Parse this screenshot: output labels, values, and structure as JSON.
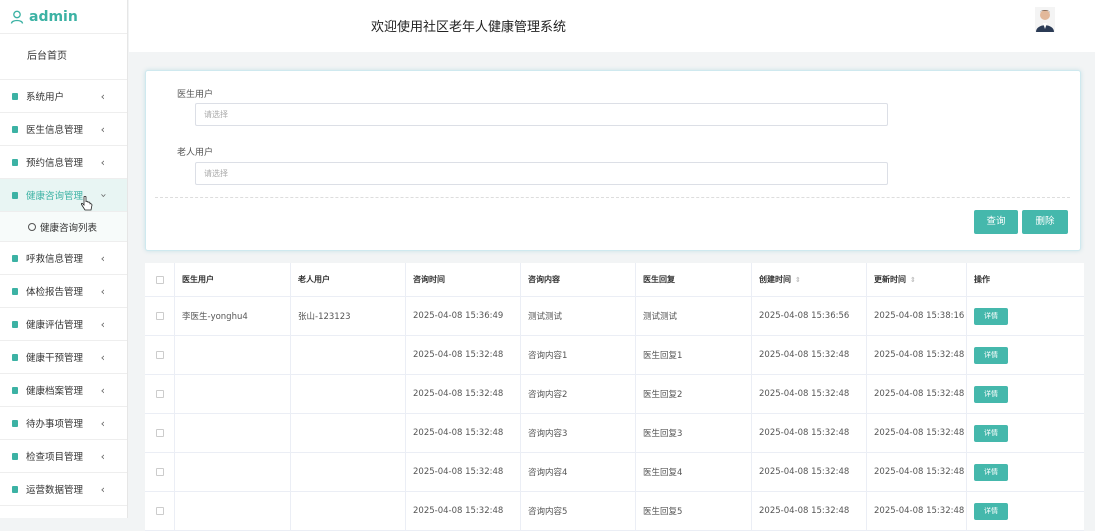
{
  "brand": {
    "username": "admin"
  },
  "header": {
    "title": "欢迎使用社区老年人健康管理系统"
  },
  "sidebar": {
    "home": "后台首页",
    "items": [
      {
        "label": "系统用户"
      },
      {
        "label": "医生信息管理"
      },
      {
        "label": "预约信息管理"
      },
      {
        "label": "健康咨询管理"
      },
      {
        "label": "呼救信息管理"
      },
      {
        "label": "体检报告管理"
      },
      {
        "label": "健康评估管理"
      },
      {
        "label": "健康干预管理"
      },
      {
        "label": "健康档案管理"
      },
      {
        "label": "待办事项管理"
      },
      {
        "label": "检查项目管理"
      },
      {
        "label": "运营数据管理"
      }
    ],
    "submenu": {
      "label": "健康咨询列表"
    }
  },
  "search": {
    "doctor_label": "医生用户",
    "doctor_placeholder": "请选择",
    "elder_label": "老人用户",
    "elder_placeholder": "请选择",
    "query_button": "查询",
    "delete_button": "删除"
  },
  "table": {
    "columns": [
      "医生用户",
      "老人用户",
      "咨询时间",
      "咨询内容",
      "医生回复",
      "创建时间",
      "更新时间",
      "操作"
    ],
    "detail_label": "详情",
    "rows": [
      {
        "doctor": "李医生-yonghu4",
        "elder": "张山-123123",
        "time": "2025-04-08 15:36:49",
        "content": "测试测试",
        "reply": "测试测试",
        "created": "2025-04-08 15:36:56",
        "updated": "2025-04-08 15:38:16"
      },
      {
        "doctor": "",
        "elder": "",
        "time": "2025-04-08 15:32:48",
        "content": "咨询内容1",
        "reply": "医生回复1",
        "created": "2025-04-08 15:32:48",
        "updated": "2025-04-08 15:32:48"
      },
      {
        "doctor": "",
        "elder": "",
        "time": "2025-04-08 15:32:48",
        "content": "咨询内容2",
        "reply": "医生回复2",
        "created": "2025-04-08 15:32:48",
        "updated": "2025-04-08 15:32:48"
      },
      {
        "doctor": "",
        "elder": "",
        "time": "2025-04-08 15:32:48",
        "content": "咨询内容3",
        "reply": "医生回复3",
        "created": "2025-04-08 15:32:48",
        "updated": "2025-04-08 15:32:48"
      },
      {
        "doctor": "",
        "elder": "",
        "time": "2025-04-08 15:32:48",
        "content": "咨询内容4",
        "reply": "医生回复4",
        "created": "2025-04-08 15:32:48",
        "updated": "2025-04-08 15:32:48"
      },
      {
        "doctor": "",
        "elder": "",
        "time": "2025-04-08 15:32:48",
        "content": "咨询内容5",
        "reply": "医生回复5",
        "created": "2025-04-08 15:32:48",
        "updated": "2025-04-08 15:32:48"
      }
    ]
  },
  "colors": {
    "accent": "#45b8ac",
    "active_bg": "#e8f5f3"
  }
}
